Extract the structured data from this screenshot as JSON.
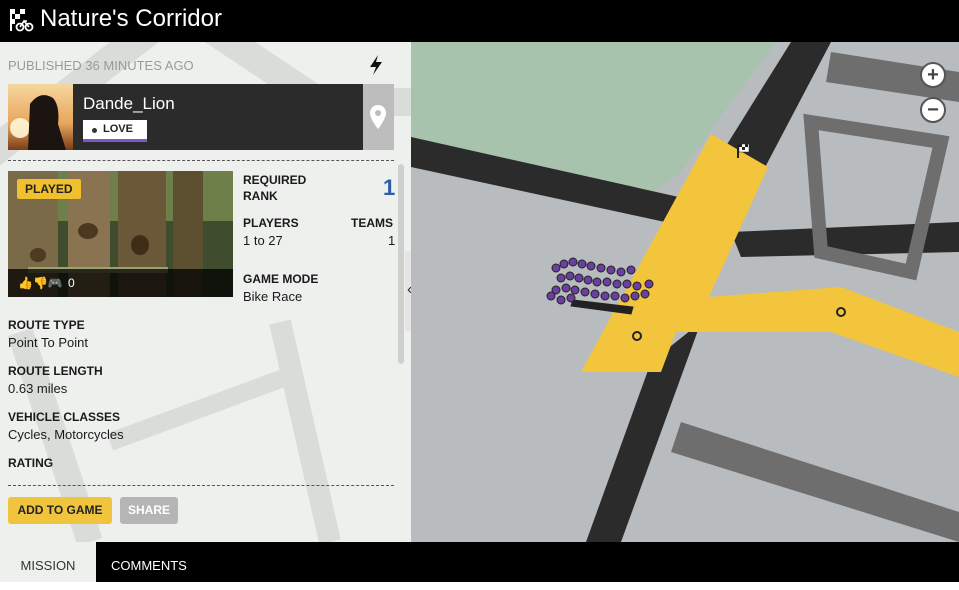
{
  "app": {
    "title": "Nature's Corridor",
    "logo_icon": "checkered-flag-bike-icon"
  },
  "panel": {
    "published": "PUBLISHED 36 MINUTES AGO",
    "creator": {
      "name": "Dande_Lion",
      "love_label": "LOVE"
    },
    "thumbnail": {
      "badge": "PLAYED",
      "votes_count": "0"
    },
    "required_rank": {
      "label": "REQUIRED RANK",
      "value": "1"
    },
    "players": {
      "label": "PLAYERS",
      "value": "1 to 27"
    },
    "teams": {
      "label": "TEAMS",
      "value": "1"
    },
    "game_mode": {
      "label": "GAME MODE",
      "value": "Bike Race"
    },
    "route_type": {
      "label": "ROUTE TYPE",
      "value": "Point To Point"
    },
    "route_length": {
      "label": "ROUTE LENGTH",
      "value": "0.63 miles"
    },
    "vehicle_classes": {
      "label": "VEHICLE CLASSES",
      "value": "Cycles, Motorcycles"
    },
    "rating": {
      "label": "RATING"
    },
    "buttons": {
      "add_to_game": "ADD TO GAME",
      "share": "SHARE"
    }
  },
  "map": {
    "zoom_in": "+",
    "zoom_out": "−"
  },
  "tabs": {
    "mission": "MISSION",
    "comments": "COMMENTS"
  },
  "colors": {
    "accent_yellow": "#f0c43c",
    "rank_blue": "#2a5fa8",
    "love_purple": "#7a58c8",
    "route_yellow": "#f2c53d"
  }
}
